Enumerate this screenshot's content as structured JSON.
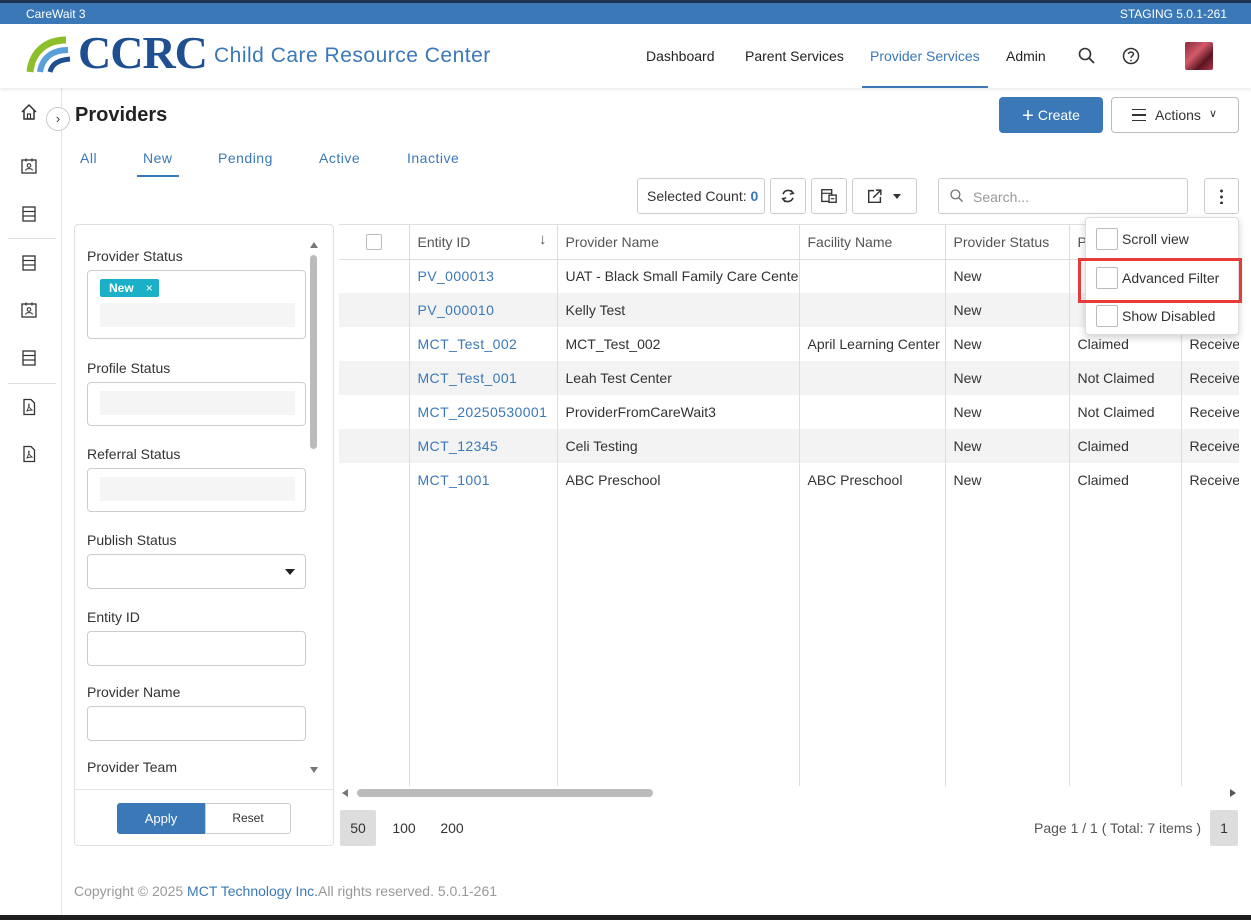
{
  "system_bar": {
    "app_name": "CareWait 3",
    "environment": "STAGING 5.0.1-261"
  },
  "header": {
    "logo_text": "CCRC",
    "logo_subtitle": "Child Care Resource Center",
    "nav": [
      "Dashboard",
      "Parent Services",
      "Provider Services",
      "Admin"
    ],
    "active_nav": "Provider Services"
  },
  "page": {
    "title": "Providers",
    "create_label": "Create",
    "actions_label": "Actions",
    "tabs": [
      "All",
      "New",
      "Pending",
      "Active",
      "Inactive"
    ],
    "active_tab": "New"
  },
  "toolbar": {
    "selected_count_label": "Selected Count:",
    "selected_count": "0",
    "search_placeholder": "Search..."
  },
  "filters": {
    "provider_status_label": "Provider Status",
    "provider_status_chip": "New",
    "chip_close": "×",
    "profile_status_label": "Profile Status",
    "referral_status_label": "Referral Status",
    "publish_status_label": "Publish Status",
    "entity_id_label": "Entity ID",
    "provider_name_label": "Provider Name",
    "provider_team_label": "Provider Team",
    "apply_label": "Apply",
    "reset_label": "Reset"
  },
  "table": {
    "columns": [
      "Entity ID",
      "Provider Name",
      "Facility Name",
      "Provider Status",
      "P",
      ""
    ],
    "rows": [
      [
        "PV_000013",
        "UAT - Black Small Family Care Center",
        "",
        "New",
        "",
        ""
      ],
      [
        "PV_000010",
        "Kelly Test",
        "",
        "New",
        "",
        ""
      ],
      [
        "MCT_Test_002",
        "MCT_Test_002",
        "April Learning Center",
        "New",
        "Claimed",
        "Receive"
      ],
      [
        "MCT_Test_001",
        "Leah Test Center",
        "",
        "New",
        "Not Claimed",
        "Receive"
      ],
      [
        "MCT_20250530001",
        "ProviderFromCareWait3",
        "",
        "New",
        "Not Claimed",
        "Receive"
      ],
      [
        "MCT_12345",
        "Celi Testing",
        "",
        "New",
        "Claimed",
        "Receive"
      ],
      [
        "MCT_1001",
        "ABC Preschool",
        "ABC Preschool",
        "New",
        "Claimed",
        "Receive"
      ]
    ]
  },
  "pager": {
    "sizes": [
      "50",
      "100",
      "200"
    ],
    "selected_size": "50",
    "info": "Page 1 / 1 ( Total: 7 items )",
    "current_page": "1"
  },
  "column_menu": {
    "items": [
      "Scroll view",
      "Advanced Filter",
      "Show Disabled"
    ],
    "highlighted": "Advanced Filter"
  },
  "footer": {
    "prefix": "Copyright © 2025 ",
    "company": "MCT Technology Inc.",
    "suffix": "All rights reserved. 5.0.1-261"
  },
  "colors": {
    "brand_blue": "#3a78b8",
    "logo_navy": "#1d4f91",
    "chip_teal": "#1ab0c8",
    "highlight_red": "#e53b3b"
  }
}
